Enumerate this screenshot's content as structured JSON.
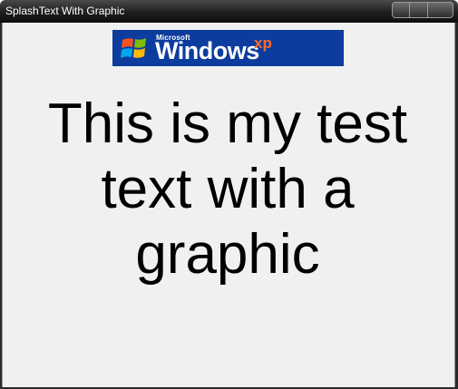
{
  "window": {
    "title": "SplashText With Graphic"
  },
  "logo": {
    "microsoft_label": "Microsoft",
    "windows_label": "Windows",
    "xp_label": "xp",
    "background_color": "#0c3c9e"
  },
  "splash": {
    "lines": [
      "This is my test",
      "text with a",
      "graphic"
    ]
  }
}
